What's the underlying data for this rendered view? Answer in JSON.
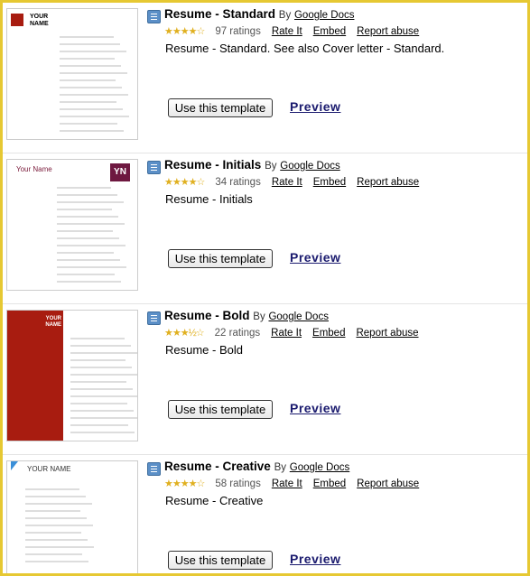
{
  "by_label": "By",
  "links": {
    "rate": "Rate It",
    "embed": "Embed",
    "report": "Report abuse"
  },
  "use_label": "Use this template",
  "preview_label": "Preview",
  "colors": {
    "frame": "#e6c832",
    "bold_red": "#a81c10",
    "star": "#e0b020",
    "preview": "#1a1a6e"
  },
  "templates": [
    {
      "title": "Resume - Standard",
      "author": "Google Docs",
      "stars": "★★★★☆",
      "rating": 4,
      "ratings": "97 ratings",
      "description": "Resume - Standard. See also Cover letter - Standard.",
      "thumb_text": "YOUR NAME"
    },
    {
      "title": "Resume - Initials",
      "author": "Google Docs",
      "stars": "★★★★☆",
      "rating": 4,
      "ratings": "34 ratings",
      "description": "Resume - Initials",
      "thumb_text": "Your Name",
      "thumb_badge": "YN"
    },
    {
      "title": "Resume - Bold",
      "author": "Google Docs",
      "stars": "★★★½☆",
      "rating": 3.5,
      "ratings": "22 ratings",
      "description": "Resume - Bold",
      "thumb_text": "YOUR NAME"
    },
    {
      "title": "Resume - Creative",
      "author": "Google Docs",
      "stars": "★★★★☆",
      "rating": 4,
      "ratings": "58 ratings",
      "description": "Resume - Creative",
      "thumb_text": "YOUR NAME"
    }
  ]
}
